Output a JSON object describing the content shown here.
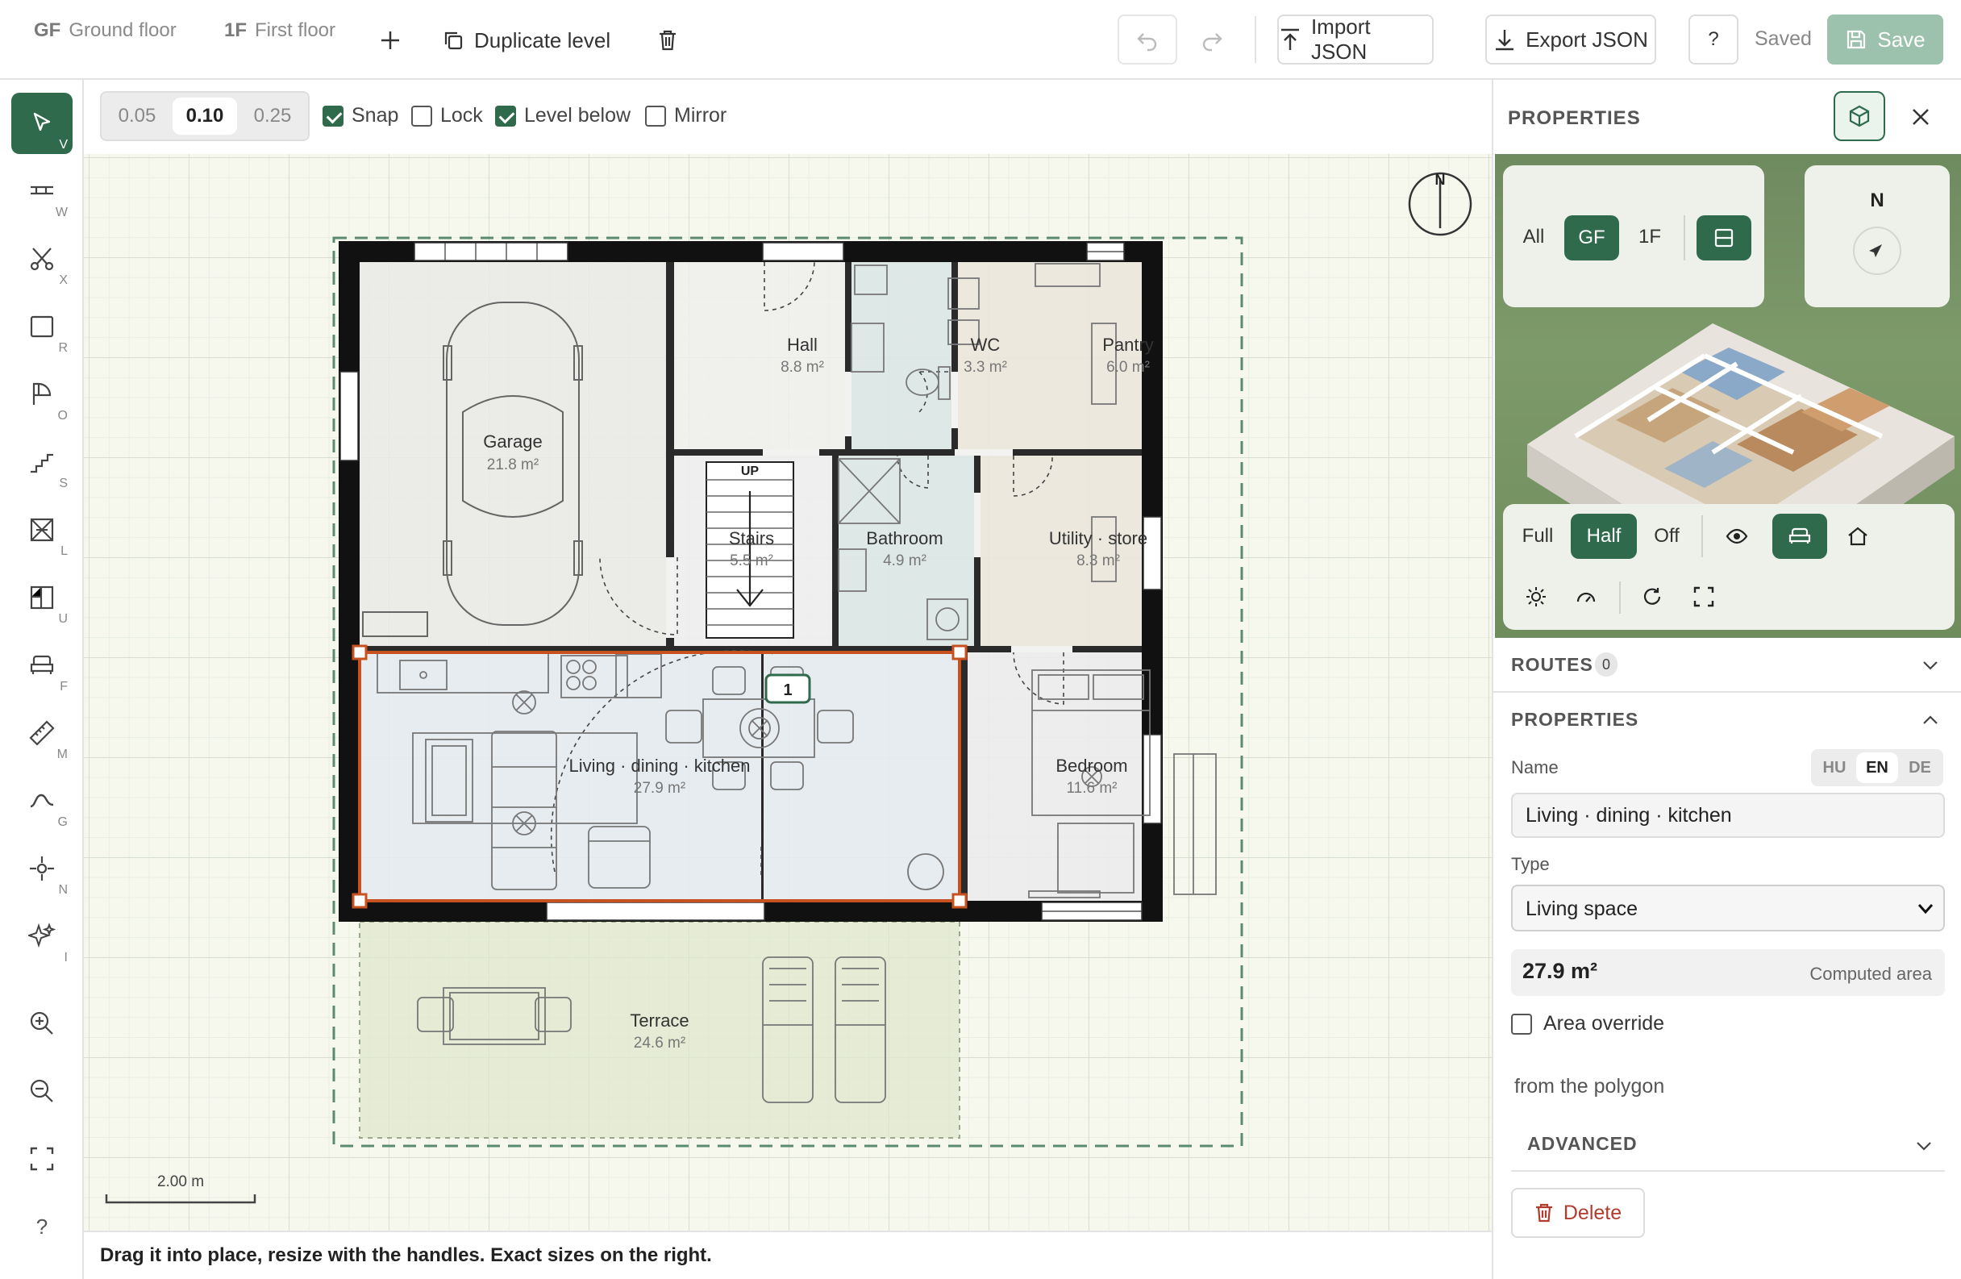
{
  "levels": [
    {
      "code": "GF",
      "name": "Ground floor"
    },
    {
      "code": "1F",
      "name": "First floor"
    }
  ],
  "topbar": {
    "duplicate_label": "Duplicate level",
    "import_label": "Import JSON",
    "export_label": "Export JSON",
    "help_label": "?",
    "status": "Saved",
    "save_label": "Save"
  },
  "tools": [
    {
      "name": "select",
      "key": "V"
    },
    {
      "name": "wall",
      "key": "W"
    },
    {
      "name": "split",
      "key": "X"
    },
    {
      "name": "room",
      "key": "R"
    },
    {
      "name": "door",
      "key": "O"
    },
    {
      "name": "stairs",
      "key": "S"
    },
    {
      "name": "window",
      "key": "L"
    },
    {
      "name": "cutout",
      "key": "U"
    },
    {
      "name": "furniture",
      "key": "F"
    },
    {
      "name": "measure",
      "key": "M"
    },
    {
      "name": "terrain",
      "key": "G"
    },
    {
      "name": "north",
      "key": "N"
    },
    {
      "name": "ai",
      "key": "I"
    }
  ],
  "bottom_tools": {
    "help": "?"
  },
  "grid_options": {
    "steps": [
      "0.05",
      "0.10",
      "0.25"
    ],
    "selected": "0.10",
    "snap": "Snap",
    "lock": "Lock",
    "level_below": "Level below",
    "mirror": "Mirror",
    "snap_on": true,
    "lock_on": false,
    "level_below_on": true,
    "mirror_on": false
  },
  "plan": {
    "rooms": [
      {
        "name": "Garage",
        "area": "21.8 m²"
      },
      {
        "name": "Hall",
        "area": "8.8 m²"
      },
      {
        "name": "WC",
        "area": "3.3 m²"
      },
      {
        "name": "Pantry",
        "area": "6.0 m²"
      },
      {
        "name": "Stairs",
        "area": "5.5 m²"
      },
      {
        "name": "Bathroom",
        "area": "4.9 m²"
      },
      {
        "name": "Utility · store",
        "area": "8.3 m²"
      },
      {
        "name": "Living · dining · kitchen",
        "area": "27.9 m²"
      },
      {
        "name": "Bedroom",
        "area": "11.6 m²"
      },
      {
        "name": "Terrace",
        "area": "24.6 m²"
      }
    ],
    "stairs_label": "UP",
    "route_marker": "1",
    "compass": "N",
    "scale": "2.00 m"
  },
  "hint": "Drag it into place, resize with the handles. Exact sizes on the right.",
  "panel": {
    "title": "PROPERTIES",
    "preview": {
      "levels": [
        "All",
        "GF",
        "1F"
      ],
      "level_selected": "GF",
      "north": "N",
      "walls": [
        "Full",
        "Half",
        "Off"
      ],
      "wall_selected": "Half"
    },
    "routes_title": "ROUTES",
    "routes_count": "0",
    "props_title": "PROPERTIES",
    "name_label": "Name",
    "langs": [
      "HU",
      "EN",
      "DE"
    ],
    "lang_selected": "EN",
    "name_value": "Living · dining · kitchen",
    "type_label": "Type",
    "type_value": "Living space",
    "area_value": "27.9 m²",
    "area_caption": "Computed area",
    "override_label": "Area override",
    "override_on": false,
    "from_polygon": "from the polygon",
    "advanced_title": "ADVANCED",
    "delete_label": "Delete"
  },
  "colors": {
    "accent": "#2f6a4d",
    "selection": "#c8521f",
    "wall": "#111111",
    "danger": "#b23b2e"
  }
}
